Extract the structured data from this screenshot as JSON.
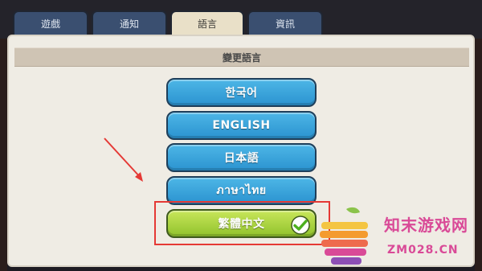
{
  "tabs": [
    {
      "label": "遊戲",
      "active": false
    },
    {
      "label": "通知",
      "active": false
    },
    {
      "label": "語言",
      "active": true
    },
    {
      "label": "資訊",
      "active": false
    }
  ],
  "panel": {
    "title": "變更語言"
  },
  "languages": [
    {
      "label": "한국어",
      "selected": false
    },
    {
      "label": "ENGLISH",
      "selected": false
    },
    {
      "label": "日本語",
      "selected": false
    },
    {
      "label": "ภาษาไทย",
      "selected": false
    },
    {
      "label": "繁體中文",
      "selected": true
    }
  ],
  "watermark": {
    "name": "知末游戏网",
    "domain": "ZM028.CN"
  },
  "colors": {
    "tab": "#3a4f70",
    "tab_active": "#e9e0c8",
    "button": "#2b93d0",
    "button_selected": "#90c22c",
    "highlight": "#e53935"
  }
}
